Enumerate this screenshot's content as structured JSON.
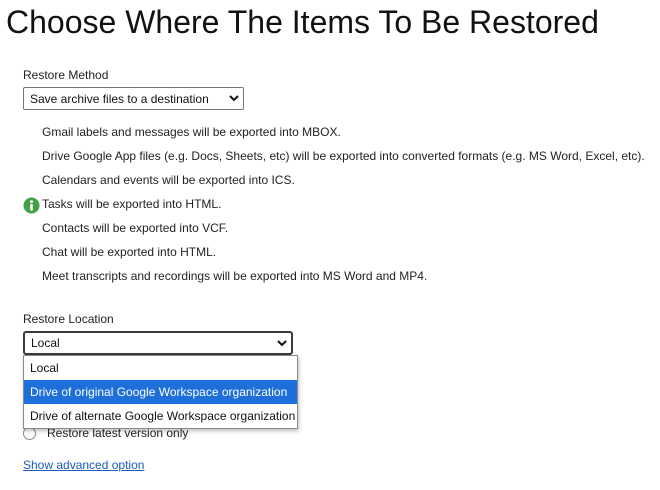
{
  "page": {
    "title": "Choose Where The Items To Be Restored"
  },
  "restore_method": {
    "label": "Restore Method",
    "selected": "Save archive files to a destination",
    "icon": "chevron-down-icon"
  },
  "info": {
    "icon": "info-icon",
    "icon_color": "#43a047",
    "lines": [
      "Gmail labels and messages will be exported into MBOX.",
      "Drive Google App files (e.g. Docs, Sheets, etc) will be exported into converted formats (e.g. MS Word, Excel, etc).",
      "Calendars and events will be exported into ICS.",
      "Tasks will be exported into HTML.",
      "Contacts will be exported into VCF.",
      "Chat will be exported into HTML.",
      "Meet transcripts and recordings will be exported into MS Word and MP4."
    ]
  },
  "restore_location": {
    "label": "Restore Location",
    "selected": "Local",
    "icon": "chevron-down-icon",
    "options": [
      "Local",
      "Drive of original Google Workspace organization",
      "Drive of alternate Google Workspace organization"
    ],
    "highlighted_option": "Drive of original Google Workspace organization"
  },
  "version_option": {
    "label": "Restore latest version only"
  },
  "advanced": {
    "link_label": "Show advanced option"
  },
  "colors": {
    "link": "#1a5bbf",
    "highlight": "#1e6fd9"
  }
}
